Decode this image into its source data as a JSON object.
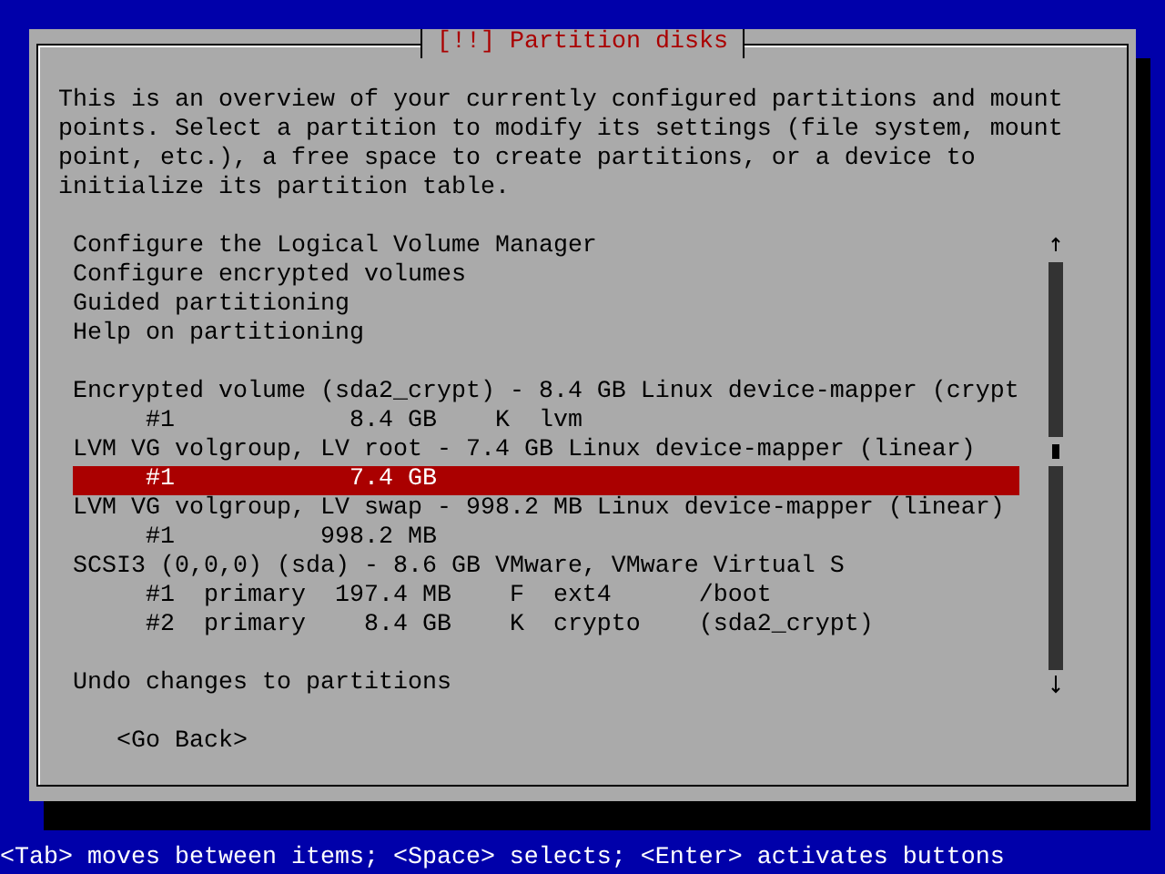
{
  "dialog": {
    "title": "[!!] Partition disks",
    "description": "This is an overview of your currently configured partitions and mount\npoints. Select a partition to modify its settings (file system, mount\npoint, etc.), a free space to create partitions, or a device to\ninitialize its partition table.",
    "menu": [
      [
        {
          "text": "Configure the Logical Volume Manager",
          "selected": false
        },
        {
          "text": "Configure encrypted volumes",
          "selected": false
        },
        {
          "text": "Guided partitioning",
          "selected": false
        },
        {
          "text": "Help on partitioning",
          "selected": false
        }
      ],
      [
        {
          "text": "Encrypted volume (sda2_crypt) - 8.4 GB Linux device-mapper (crypt",
          "selected": false
        },
        {
          "text": "     #1            8.4 GB    K  lvm",
          "selected": false
        },
        {
          "text": "LVM VG volgroup, LV root - 7.4 GB Linux device-mapper (linear)",
          "selected": false
        },
        {
          "text": "     #1            7.4 GB",
          "selected": true
        },
        {
          "text": "LVM VG volgroup, LV swap - 998.2 MB Linux device-mapper (linear)",
          "selected": false
        },
        {
          "text": "     #1          998.2 MB",
          "selected": false
        },
        {
          "text": "SCSI3 (0,0,0) (sda) - 8.6 GB VMware, VMware Virtual S",
          "selected": false
        },
        {
          "text": "     #1  primary  197.4 MB    F  ext4      /boot",
          "selected": false
        },
        {
          "text": "     #2  primary    8.4 GB    K  crypto    (sda2_crypt)",
          "selected": false
        }
      ],
      [
        {
          "text": "Undo changes to partitions",
          "selected": false
        }
      ]
    ],
    "back_button": "<Go Back>"
  },
  "status_bar": "<Tab> moves between items; <Space> selects; <Enter> activates buttons"
}
